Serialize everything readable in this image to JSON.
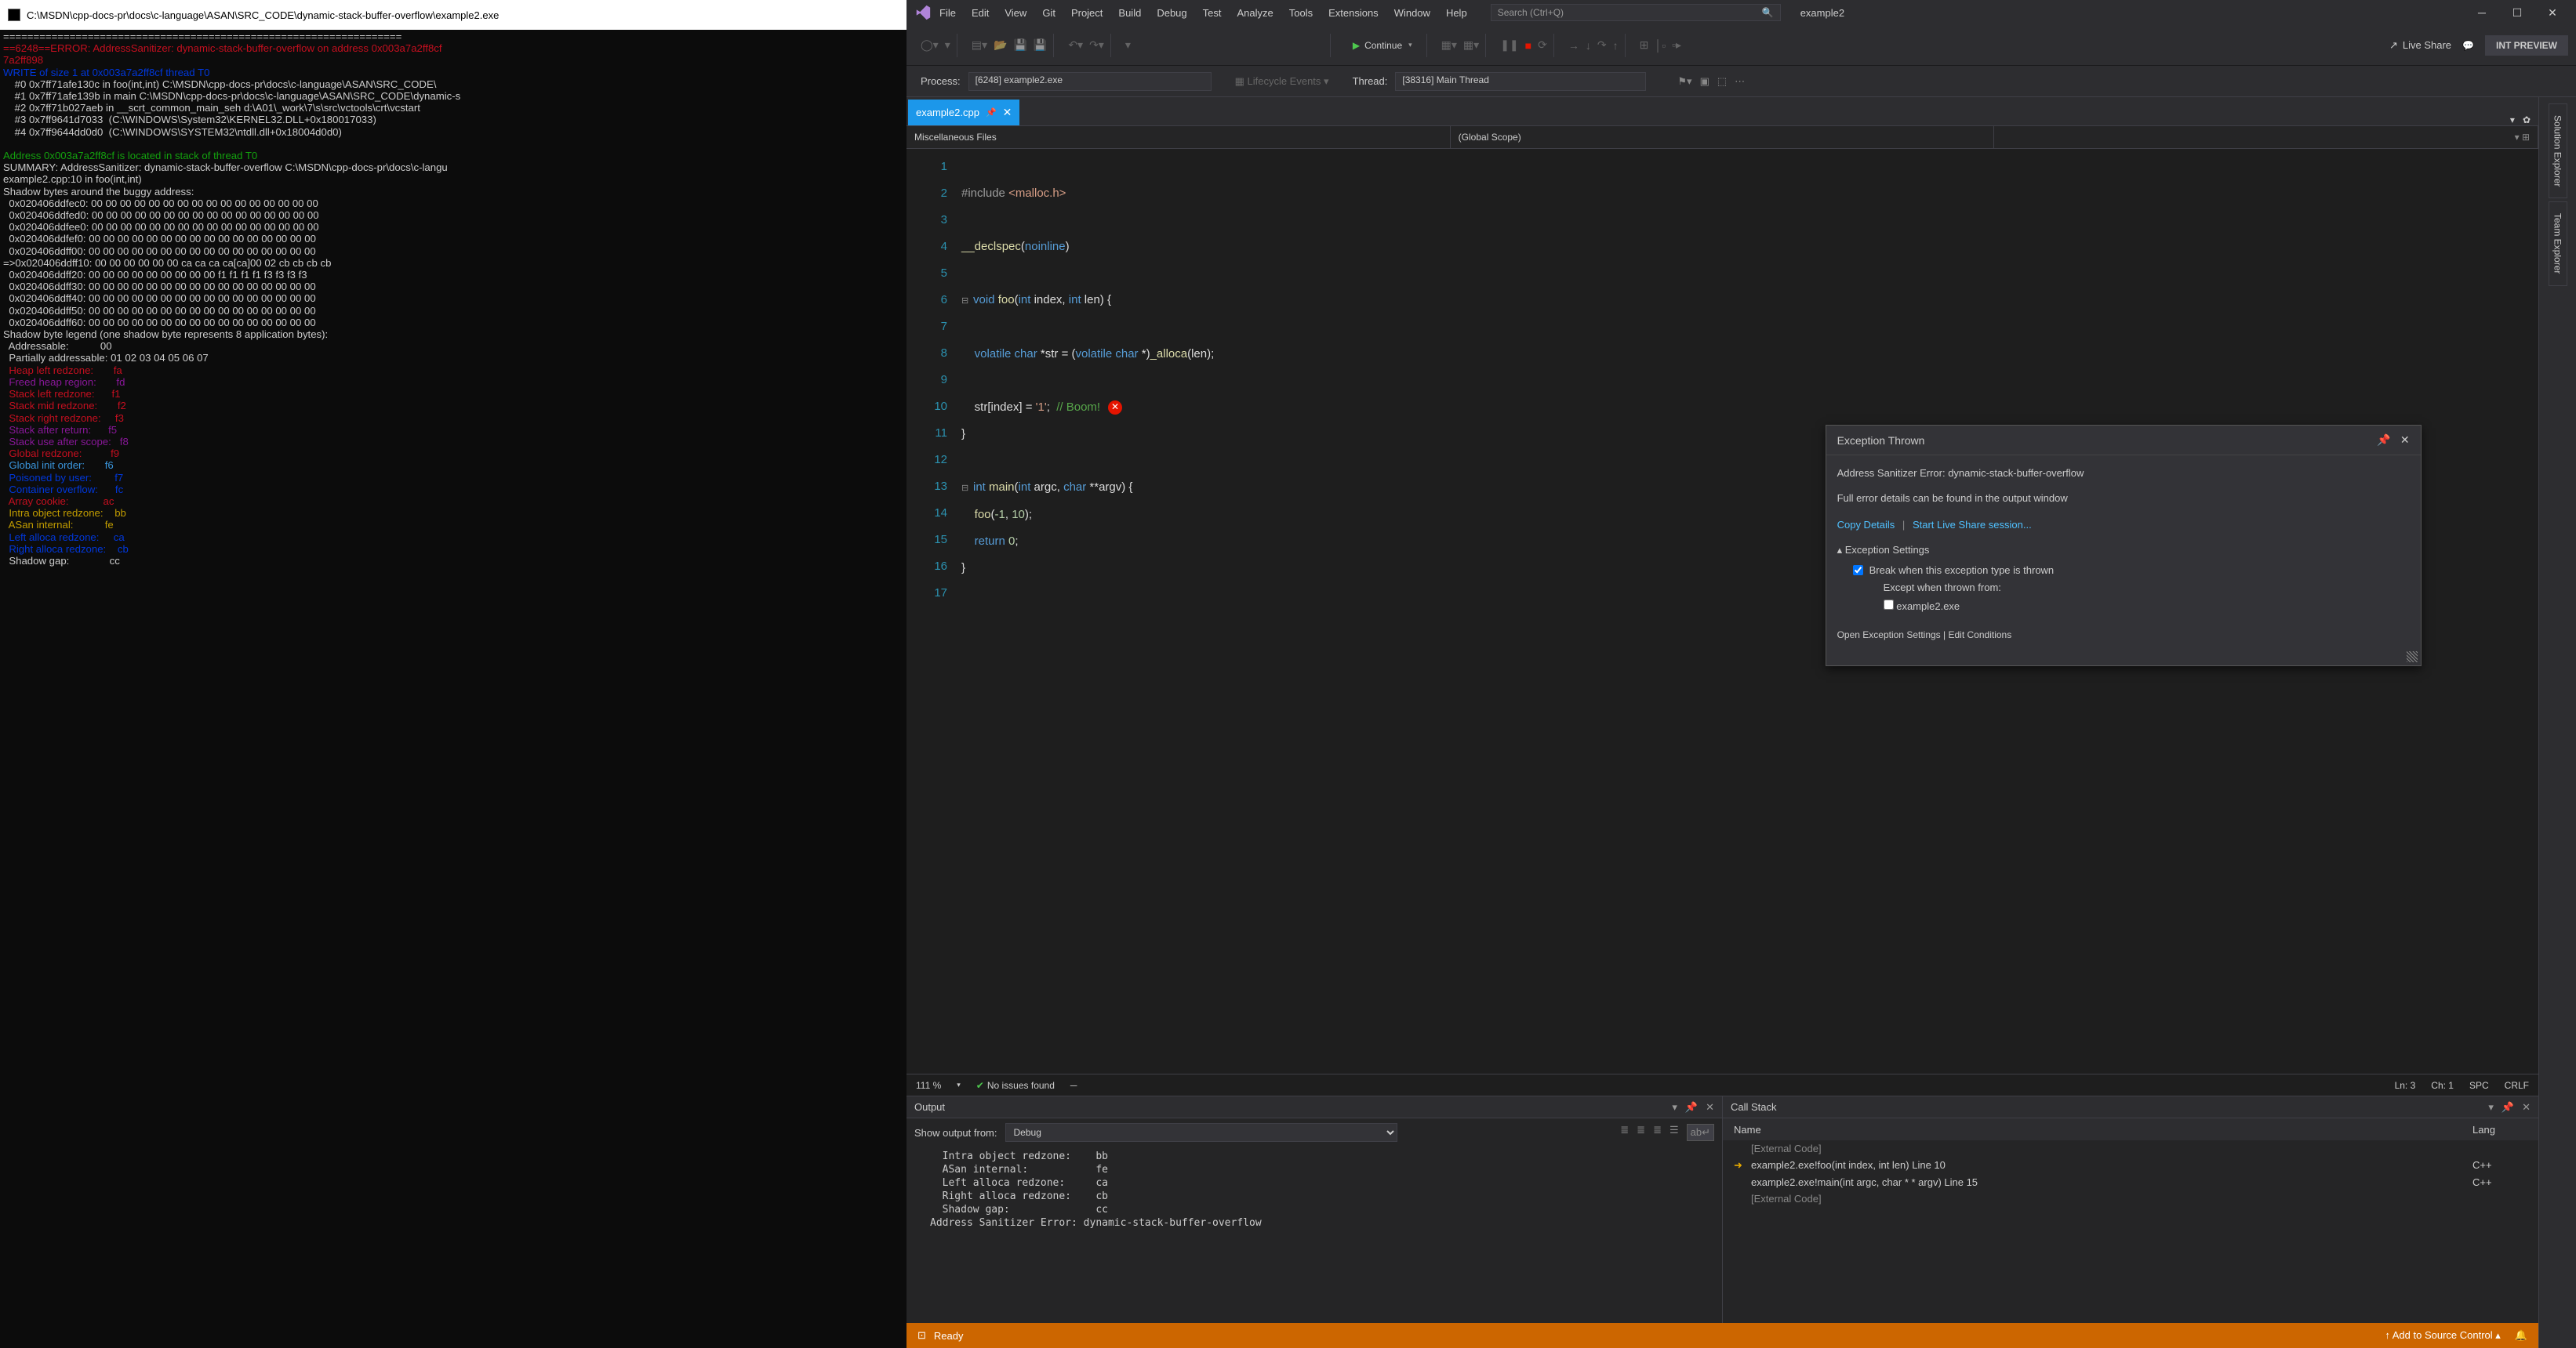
{
  "console": {
    "title": "C:\\MSDN\\cpp-docs-pr\\docs\\c-language\\ASAN\\SRC_CODE\\dynamic-stack-buffer-overflow\\example2.exe",
    "lines": [
      {
        "cls": "",
        "txt": "=================================================================="
      },
      {
        "cls": "red",
        "txt": "==6248==ERROR: AddressSanitizer: dynamic-stack-buffer-overflow on address 0x003a7a2ff8cf"
      },
      {
        "cls": "red",
        "txt": "7a2ff898"
      },
      {
        "cls": "blue",
        "txt": "WRITE of size 1 at 0x003a7a2ff8cf thread T0"
      },
      {
        "cls": "",
        "txt": "    #0 0x7ff71afe130c in foo(int,int) C:\\MSDN\\cpp-docs-pr\\docs\\c-language\\ASAN\\SRC_CODE\\"
      },
      {
        "cls": "",
        "txt": "    #1 0x7ff71afe139b in main C:\\MSDN\\cpp-docs-pr\\docs\\c-language\\ASAN\\SRC_CODE\\dynamic-s"
      },
      {
        "cls": "",
        "txt": "    #2 0x7ff71b027aeb in __scrt_common_main_seh d:\\A01\\_work\\7\\s\\src\\vctools\\crt\\vcstart"
      },
      {
        "cls": "",
        "txt": "    #3 0x7ff9641d7033  (C:\\WINDOWS\\System32\\KERNEL32.DLL+0x180017033)"
      },
      {
        "cls": "",
        "txt": "    #4 0x7ff9644dd0d0  (C:\\WINDOWS\\SYSTEM32\\ntdll.dll+0x18004d0d0)"
      },
      {
        "cls": "",
        "txt": ""
      },
      {
        "cls": "grn",
        "txt": "Address 0x003a7a2ff8cf is located in stack of thread T0"
      },
      {
        "cls": "",
        "txt": "SUMMARY: AddressSanitizer: dynamic-stack-buffer-overflow C:\\MSDN\\cpp-docs-pr\\docs\\c-langu"
      },
      {
        "cls": "",
        "txt": "example2.cpp:10 in foo(int,int)"
      },
      {
        "cls": "",
        "txt": "Shadow bytes around the buggy address:"
      },
      {
        "cls": "",
        "txt": "  0x020406ddfec0: 00 00 00 00 00 00 00 00 00 00 00 00 00 00 00 00"
      },
      {
        "cls": "",
        "txt": "  0x020406ddfed0: 00 00 00 00 00 00 00 00 00 00 00 00 00 00 00 00"
      },
      {
        "cls": "",
        "txt": "  0x020406ddfee0: 00 00 00 00 00 00 00 00 00 00 00 00 00 00 00 00"
      },
      {
        "cls": "",
        "txt": "  0x020406ddfef0: 00 00 00 00 00 00 00 00 00 00 00 00 00 00 00 00"
      },
      {
        "cls": "",
        "txt": "  0x020406ddff00: 00 00 00 00 00 00 00 00 00 00 00 00 00 00 00 00"
      },
      {
        "cls": "yellowrow",
        "txt": "=>0x020406ddff10: 00 00 00 00 00 00 ca ca ca ca[ca]00 02 cb cb cb cb"
      },
      {
        "cls": "",
        "txt": "  0x020406ddff20: 00 00 00 00 00 00 00 00 00 f1 f1 f1 f1 f3 f3 f3 f3"
      },
      {
        "cls": "",
        "txt": "  0x020406ddff30: 00 00 00 00 00 00 00 00 00 00 00 00 00 00 00 00"
      },
      {
        "cls": "",
        "txt": "  0x020406ddff40: 00 00 00 00 00 00 00 00 00 00 00 00 00 00 00 00"
      },
      {
        "cls": "",
        "txt": "  0x020406ddff50: 00 00 00 00 00 00 00 00 00 00 00 00 00 00 00 00"
      },
      {
        "cls": "",
        "txt": "  0x020406ddff60: 00 00 00 00 00 00 00 00 00 00 00 00 00 00 00 00"
      },
      {
        "cls": "",
        "txt": "Shadow byte legend (one shadow byte represents 8 application bytes):"
      },
      {
        "cls": "",
        "txt": "  Addressable:           00"
      },
      {
        "cls": "",
        "txt": "  Partially addressable: 01 02 03 04 05 06 07"
      },
      {
        "cls": "red",
        "txt": "  Heap left redzone:       fa"
      },
      {
        "cls": "mag",
        "txt": "  Freed heap region:       fd"
      },
      {
        "cls": "red",
        "txt": "  Stack left redzone:      f1"
      },
      {
        "cls": "red",
        "txt": "  Stack mid redzone:       f2"
      },
      {
        "cls": "red",
        "txt": "  Stack right redzone:     f3"
      },
      {
        "cls": "mag",
        "txt": "  Stack after return:      f5"
      },
      {
        "cls": "mag",
        "txt": "  Stack use after scope:   f8"
      },
      {
        "cls": "red",
        "txt": "  Global redzone:          f9"
      },
      {
        "cls": "cyan",
        "txt": "  Global init order:       f6"
      },
      {
        "cls": "blue",
        "txt": "  Poisoned by user:        f7"
      },
      {
        "cls": "blue",
        "txt": "  Container overflow:      fc"
      },
      {
        "cls": "red",
        "txt": "  Array cookie:            ac"
      },
      {
        "cls": "yel",
        "txt": "  Intra object redzone:    bb"
      },
      {
        "cls": "yel",
        "txt": "  ASan internal:           fe"
      },
      {
        "cls": "blue",
        "txt": "  Left alloca redzone:     ca"
      },
      {
        "cls": "blue",
        "txt": "  Right alloca redzone:    cb"
      },
      {
        "cls": "",
        "txt": "  Shadow gap:              cc"
      }
    ]
  },
  "vs": {
    "menu": [
      "File",
      "Edit",
      "View",
      "Git",
      "Project",
      "Build",
      "Debug",
      "Test",
      "Analyze",
      "Tools",
      "Extensions",
      "Window",
      "Help"
    ],
    "search_placeholder": "Search (Ctrl+Q)",
    "solution": "example2",
    "continue_label": "Continue",
    "liveshare": "Live Share",
    "int_preview": "INT PREVIEW",
    "process_label": "Process:",
    "process_value": "[6248] example2.exe",
    "lifecycle_label": "Lifecycle Events",
    "thread_label": "Thread:",
    "thread_value": "[38316] Main Thread",
    "tab": {
      "label": "example2.cpp"
    },
    "nav": {
      "left": "Miscellaneous Files",
      "mid": "(Global Scope)"
    },
    "code_lines": [
      "",
      "<span class='inc'>#include</span> <span class='incstr'>&lt;malloc.h&gt;</span>",
      "",
      "<span class='fn'>__declspec</span>(<span class='kw'>noinline</span>)",
      "",
      "<span class='fold'>⊟</span><span class='kw'>void</span> <span class='fn'>foo</span>(<span class='kw'>int</span> index, <span class='kw'>int</span> len) {",
      "",
      "    <span class='kw'>volatile</span> <span class='kw'>char</span> *str = (<span class='kw'>volatile</span> <span class='kw'>char</span> *)<span class='fn'>_alloca</span>(len);",
      "",
      "    str[index] = <span class='str'>'1'</span>;  <span class='cm'>// Boom!</span><span class='err-dot'>✕</span>",
      "}",
      "",
      "<span class='fold'>⊟</span><span class='kw'>int</span> <span class='fn'>main</span>(<span class='kw'>int</span> argc, <span class='kw'>char</span> **argv) {",
      "    <span class='fn'>foo</span>(<span class='num'>-1</span>, <span class='num'>10</span>);",
      "    <span class='kw'>return</span> <span class='num'>0</span>;",
      "}",
      ""
    ],
    "exception": {
      "title": "Exception Thrown",
      "subtitle": "Address Sanitizer Error: dynamic-stack-buffer-overflow",
      "detail": "Full error details can be found in the output window",
      "copy": "Copy Details",
      "start_ls": "Start Live Share session...",
      "settings_hd": "Exception Settings",
      "break_label": "Break when this exception type is thrown",
      "except_label": "Except when thrown from:",
      "except_item": "example2.exe",
      "open_settings": "Open Exception Settings",
      "edit_cond": "Edit Conditions"
    },
    "statusrow": {
      "zoom": "111 %",
      "issues": "No issues found",
      "ln": "Ln: 3",
      "ch": "Ch: 1",
      "spc": "SPC",
      "crlf": "CRLF"
    },
    "output": {
      "title": "Output",
      "show_label": "Show output from:",
      "show_value": "Debug",
      "lines": [
        "  Intra object redzone:    bb",
        "  ASan internal:           fe",
        "  Left alloca redzone:     ca",
        "  Right alloca redzone:    cb",
        "  Shadow gap:              cc",
        "Address Sanitizer Error: dynamic-stack-buffer-overflow"
      ]
    },
    "callstack": {
      "title": "Call Stack",
      "col_name": "Name",
      "col_lang": "Lang",
      "rows": [
        {
          "ext": true,
          "name": "[External Code]",
          "lang": ""
        },
        {
          "ext": false,
          "arrow": true,
          "name": "example2.exe!foo(int index, int len) Line 10",
          "lang": "C++"
        },
        {
          "ext": false,
          "name": "example2.exe!main(int argc, char * * argv) Line 15",
          "lang": "C++"
        },
        {
          "ext": true,
          "name": "[External Code]",
          "lang": ""
        }
      ]
    },
    "side_tabs": [
      "Solution Explorer",
      "Team Explorer"
    ],
    "statusbar": {
      "ready": "Ready",
      "add_source": "Add to Source Control"
    }
  }
}
